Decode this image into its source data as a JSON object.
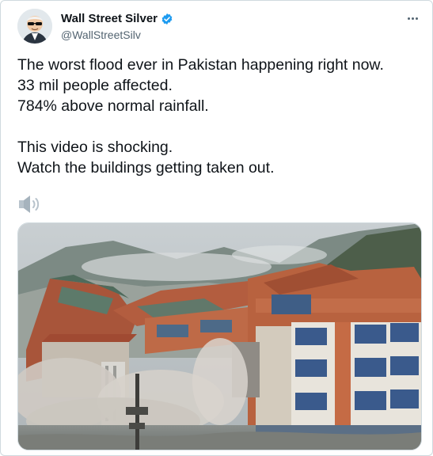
{
  "tweet": {
    "author": {
      "display_name": "Wall Street Silver",
      "handle": "@WallStreetSilv",
      "verified": true
    },
    "text_lines": [
      "The worst flood ever in Pakistan happening right now.",
      "33 mil people affected.",
      "784% above normal rainfall.",
      "This video is shocking.",
      "Watch the buildings getting taken out."
    ],
    "icons": {
      "verified": "verified-badge-icon",
      "more": "more-options-icon",
      "sound": "speaker-icon"
    },
    "colors": {
      "accent": "#1d9bf0",
      "text": "#0f1419",
      "secondary": "#536471"
    }
  }
}
